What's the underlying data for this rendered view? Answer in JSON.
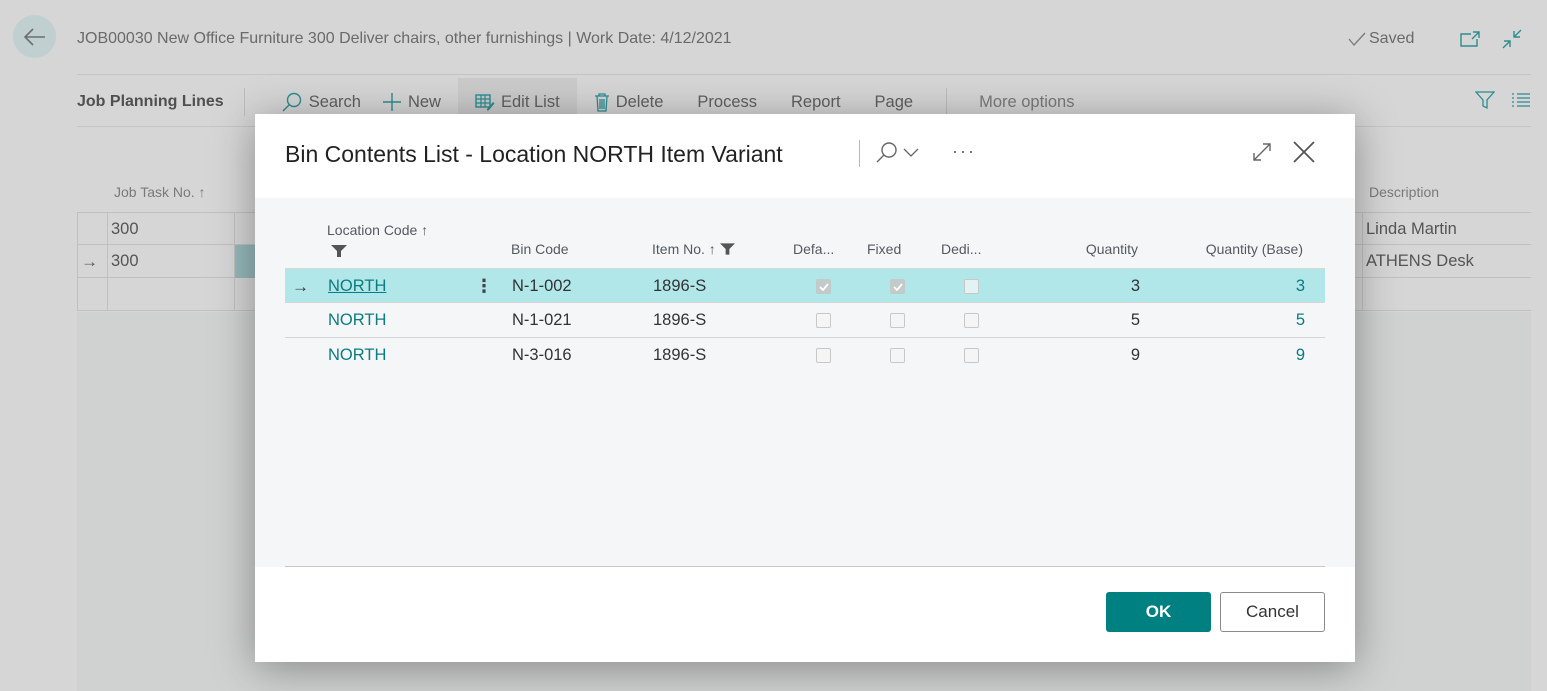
{
  "background_page": {
    "title": "JOB00030 New Office Furniture 300 Deliver chairs, other furnishings | Work Date: 4/12/2021",
    "saved_status": "Saved",
    "icons": {
      "back": "arrow-left-icon",
      "open_new_window": "open-in-new-window-icon",
      "collapse": "collapse-icon"
    },
    "action_bar": {
      "title": "Job Planning Lines",
      "items": [
        {
          "label": "Search",
          "icon": "search-icon"
        },
        {
          "label": "New",
          "icon": "plus-icon"
        },
        {
          "label": "Edit List",
          "icon": "edit-list-icon",
          "active": true
        },
        {
          "label": "Delete",
          "icon": "trash-icon"
        },
        {
          "label": "Process"
        },
        {
          "label": "Report"
        },
        {
          "label": "Page"
        }
      ],
      "more_options": "More options",
      "right_icons": [
        "filter-icon",
        "list-view-icon"
      ]
    },
    "grid": {
      "columns": {
        "job_task_no": "Job Task No. ↑",
        "description": "Description"
      },
      "rows": [
        {
          "job_task_no": "300",
          "description": "Linda Martin",
          "current": false
        },
        {
          "job_task_no": "300",
          "description": "ATHENS Desk",
          "current": true
        },
        {
          "job_task_no": "",
          "description": "",
          "current": false
        }
      ]
    }
  },
  "modal": {
    "title": "Bin Contents List - Location NORTH Item Variant",
    "icons": {
      "search": "search-icon",
      "chevron": "chevron-down-icon",
      "more": "more-options-icon",
      "expand": "expand-icon",
      "close": "close-icon"
    },
    "columns": {
      "location_code": "Location Code ↑",
      "bin_code": "Bin Code",
      "item_no": "Item No. ↑",
      "default": "Defa...",
      "fixed": "Fixed",
      "dedicated": "Dedi...",
      "quantity": "Quantity",
      "quantity_base": "Quantity (Base)"
    },
    "rows": [
      {
        "location_code": "NORTH",
        "bin_code": "N-1-002",
        "item_no": "1896-S",
        "default": true,
        "fixed": true,
        "dedicated": false,
        "quantity": "3",
        "quantity_base": "3",
        "selected": true
      },
      {
        "location_code": "NORTH",
        "bin_code": "N-1-021",
        "item_no": "1896-S",
        "default": false,
        "fixed": false,
        "dedicated": false,
        "quantity": "5",
        "quantity_base": "5",
        "selected": false
      },
      {
        "location_code": "NORTH",
        "bin_code": "N-3-016",
        "item_no": "1896-S",
        "default": false,
        "fixed": false,
        "dedicated": false,
        "quantity": "9",
        "quantity_base": "9",
        "selected": false
      }
    ],
    "buttons": {
      "ok": "OK",
      "cancel": "Cancel"
    }
  },
  "colors": {
    "accent": "#008080",
    "link": "#0b7c81",
    "selected_row": "#b2e7ea"
  }
}
